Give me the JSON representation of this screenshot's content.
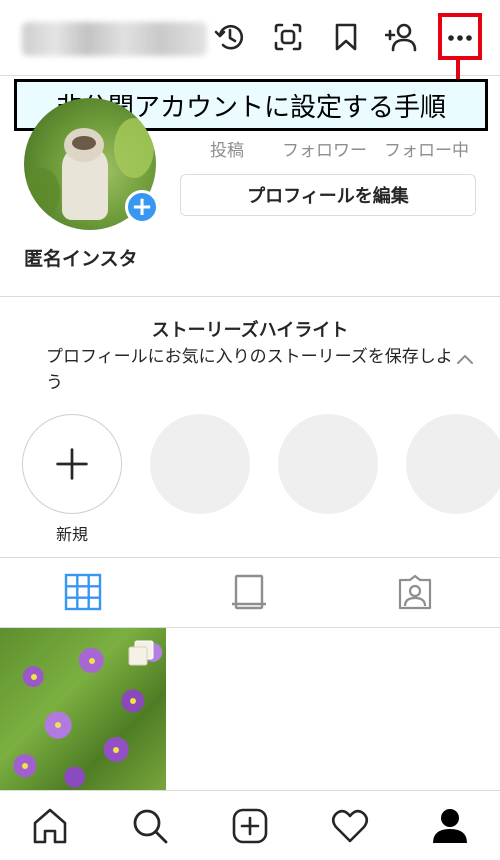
{
  "annotation": {
    "banner_text": "非公開アカウントに設定する手順",
    "highlight_color": "#e60012"
  },
  "header": {
    "icons": [
      "history-icon",
      "qr-scan-icon",
      "bookmark-icon",
      "add-person-icon",
      "more-options-icon"
    ]
  },
  "profile": {
    "display_name": "匿名インスタ",
    "stats": {
      "posts_label": "投稿",
      "followers_label": "フォロワー",
      "following_label": "フォロー中"
    },
    "edit_button_label": "プロフィールを編集"
  },
  "highlights": {
    "title": "ストーリーズハイライト",
    "description": "プロフィールにお気に入りのストーリーズを保存しよう",
    "new_label": "新規"
  },
  "tabs": [
    "grid-icon",
    "reels-icon",
    "tagged-icon"
  ],
  "bottom_nav": [
    "home-icon",
    "search-icon",
    "create-icon",
    "heart-icon",
    "profile-icon"
  ],
  "colors": {
    "accent": "#3897f0",
    "divider": "#dbdbdb",
    "muted_text": "#8e8e8e",
    "banner_bg": "#eafcff"
  }
}
